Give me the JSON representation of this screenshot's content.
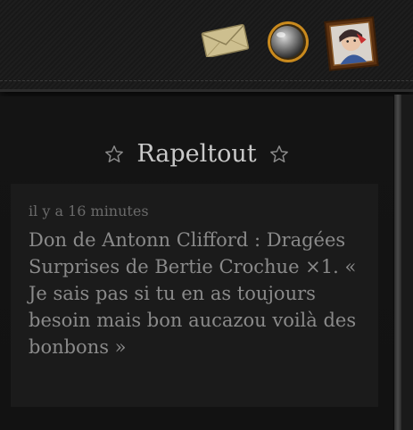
{
  "header": {
    "icons": [
      "envelope-icon",
      "crystal-ball-icon",
      "profile-portrait"
    ]
  },
  "section": {
    "title": "Rapeltout",
    "title_icons": [
      "star-outline-icon",
      "star-outline-icon"
    ]
  },
  "notification": {
    "time": "il y a 16 minutes",
    "text": "Don de Antonn Clifford : Dragées Surprises de Bertie Crochue ×1. « Je sais pas si tu en as toujours besoin mais bon aucazou voilà des bonbons »"
  },
  "colors": {
    "background": "#161616",
    "card": "#1b1b1b",
    "title_text": "#c9c9c9",
    "body_text": "#8a8a8a",
    "muted_text": "#6a6a6a"
  }
}
